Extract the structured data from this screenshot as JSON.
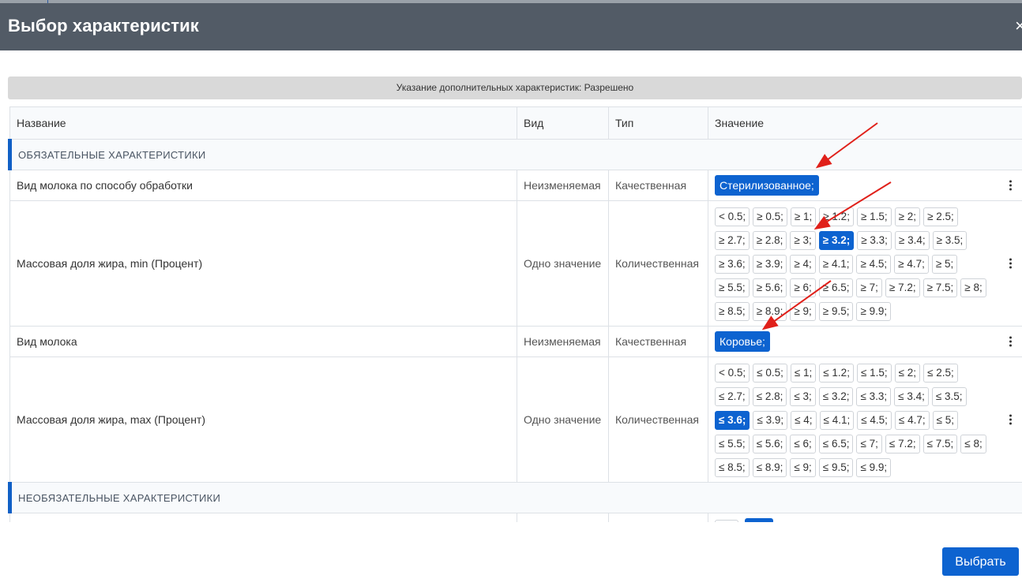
{
  "dialog": {
    "title": "Выбор характеристик",
    "close_glyph": "×",
    "info_banner": "Указание дополнительных характеристик: Разрешено",
    "select_button": "Выбрать"
  },
  "table": {
    "headers": [
      "Название",
      "Вид",
      "Тип",
      "Значение"
    ],
    "section_required": "ОБЯЗАТЕЛЬНЫЕ ХАРАКТЕРИСТИКИ",
    "section_optional": "НЕОБЯЗАТЕЛЬНЫЕ ХАРАКТЕРИСТИКИ",
    "rows": [
      {
        "name": "Вид молока по способу обработки",
        "kind": "Неизменяемая",
        "type": "Качественная",
        "value": "Стерилизованное;"
      },
      {
        "name": "Массовая доля жира, min (Процент)",
        "kind": "Одно значение",
        "type": "Количественная",
        "options": [
          "< 0.5;",
          "≥ 0.5;",
          "≥ 1;",
          "≥ 1.2;",
          "≥ 1.5;",
          "≥ 2;",
          "≥ 2.5;",
          "≥ 2.7;",
          "≥ 2.8;",
          "≥ 3;",
          "≥ 3.2;",
          "≥ 3.3;",
          "≥ 3.4;",
          "≥ 3.5;",
          "≥ 3.6;",
          "≥ 3.9;",
          "≥ 4;",
          "≥ 4.1;",
          "≥ 4.5;",
          "≥ 4.7;",
          "≥ 5;",
          "≥ 5.5;",
          "≥ 5.6;",
          "≥ 6;",
          "≥ 6.5;",
          "≥ 7;",
          "≥ 7.2;",
          "≥ 7.5;",
          "≥ 8;",
          "≥ 8.5;",
          "≥ 8.9;",
          "≥ 9;",
          "≥ 9.5;",
          "≥ 9.9;"
        ],
        "selected": "≥ 3.2;"
      },
      {
        "name": "Вид молока",
        "kind": "Неизменяемая",
        "type": "Качественная",
        "value": "Коровье;"
      },
      {
        "name": "Массовая доля жира, max (Процент)",
        "kind": "Одно значение",
        "type": "Количественная",
        "options": [
          "< 0.5;",
          "≤ 0.5;",
          "≤ 1;",
          "≤ 1.2;",
          "≤ 1.5;",
          "≤ 2;",
          "≤ 2.5;",
          "≤ 2.7;",
          "≤ 2.8;",
          "≤ 3;",
          "≤ 3.2;",
          "≤ 3.3;",
          "≤ 3.4;",
          "≤ 3.5;",
          "≤ 3.6;",
          "≤ 3.9;",
          "≤ 4;",
          "≤ 4.1;",
          "≤ 4.5;",
          "≤ 4.7;",
          "≤ 5;",
          "≤ 5.5;",
          "≤ 5.6;",
          "≤ 6;",
          "≤ 6.5;",
          "≤ 7;",
          "≤ 7.2;",
          "≤ 7.5;",
          "≤ 8;",
          "≤ 8.5;",
          "≤ 8.9;",
          "≤ 9;",
          "≤ 9.5;",
          "≤ 9.9;"
        ],
        "selected": "≤ 3.6;"
      }
    ]
  },
  "colors": {
    "accent": "#0d63d0",
    "header_bg": "#525b66",
    "annotation_arrow": "#e0201a"
  }
}
